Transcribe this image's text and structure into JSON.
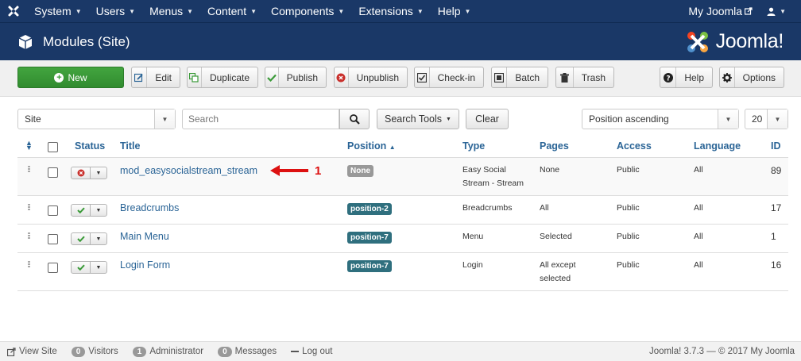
{
  "navbar": {
    "menus": [
      "System",
      "Users",
      "Menus",
      "Content",
      "Components",
      "Extensions",
      "Help"
    ],
    "site_link": "My Joomla",
    "user_menu": "user"
  },
  "header": {
    "title": "Modules (Site)",
    "brand": "Joomla!"
  },
  "toolbar": {
    "new": "New",
    "edit": "Edit",
    "duplicate": "Duplicate",
    "publish": "Publish",
    "unpublish": "Unpublish",
    "checkin": "Check-in",
    "batch": "Batch",
    "trash": "Trash",
    "help": "Help",
    "options": "Options"
  },
  "filters": {
    "client": "Site",
    "search_placeholder": "Search",
    "search_tools": "Search Tools",
    "clear": "Clear",
    "ordering": "Position ascending",
    "limit": "20"
  },
  "table": {
    "columns": {
      "status": "Status",
      "title": "Title",
      "position": "Position",
      "type": "Type",
      "pages": "Pages",
      "access": "Access",
      "language": "Language",
      "id": "ID"
    },
    "rows": [
      {
        "status": "unpublished",
        "title": "mod_easysocialstream_stream",
        "position": "None",
        "type": "Easy Social Stream - Stream",
        "pages": "None",
        "access": "Public",
        "language": "All",
        "id": "89"
      },
      {
        "status": "published",
        "title": "Breadcrumbs",
        "position": "position-2",
        "type": "Breadcrumbs",
        "pages": "All",
        "access": "Public",
        "language": "All",
        "id": "17"
      },
      {
        "status": "published",
        "title": "Main Menu",
        "position": "position-7",
        "type": "Menu",
        "pages": "Selected",
        "access": "Public",
        "language": "All",
        "id": "1"
      },
      {
        "status": "published",
        "title": "Login Form",
        "position": "position-7",
        "type": "Login",
        "pages": "All except selected",
        "access": "Public",
        "language": "All",
        "id": "16"
      }
    ]
  },
  "annotation": {
    "number": "1"
  },
  "footer": {
    "view_site": "View Site",
    "visitors_count": "0",
    "visitors": "Visitors",
    "admins_count": "1",
    "admins": "Administrator",
    "messages_count": "0",
    "messages": "Messages",
    "logout": "Log out",
    "copyright": "Joomla! 3.7.3  —  © 2017 My Joomla"
  },
  "colors": {
    "navbar": "#1a3867",
    "new_button": "#3a9a38",
    "link": "#2a6496",
    "position_badge": "#2f6f7e",
    "published": "#3a9a38",
    "unpublished": "#c9302c",
    "annotation": "#dd1111"
  }
}
